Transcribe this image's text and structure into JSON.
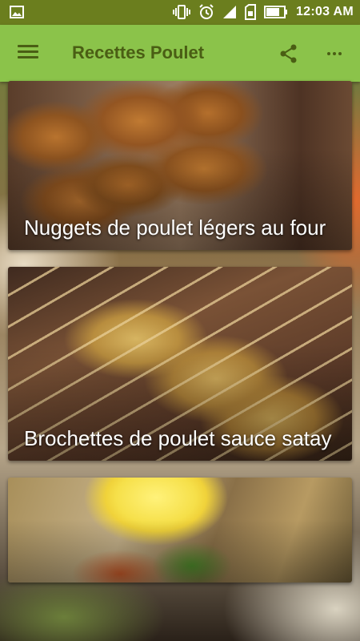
{
  "status_bar": {
    "time": "12:03 AM",
    "icons": [
      "image-icon",
      "vibrate-icon",
      "alarm-icon",
      "signal-icon",
      "sim-icon",
      "battery-icon"
    ]
  },
  "app_bar": {
    "title": "Recettes Poulet",
    "color": "#8bc34a",
    "icons": [
      "menu-icon",
      "share-icon",
      "more-vert-icon"
    ]
  },
  "recipes": [
    {
      "title": "Nuggets de poulet légers au four"
    },
    {
      "title": "Brochettes de poulet sauce satay"
    },
    {
      "title": ""
    }
  ]
}
